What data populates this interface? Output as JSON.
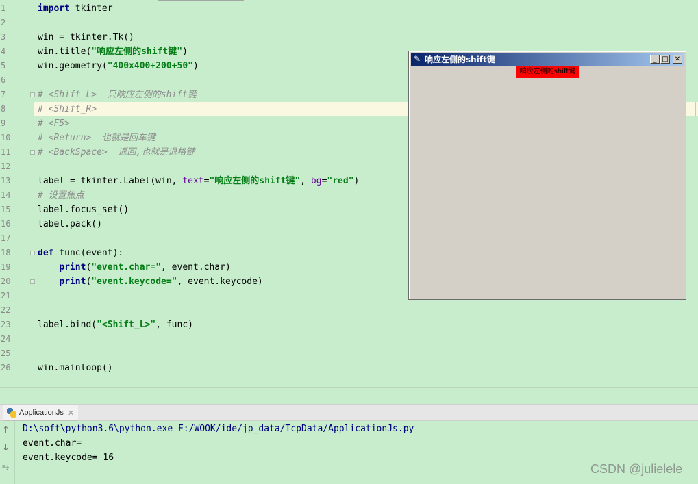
{
  "editor": {
    "lines": [
      {
        "n": "1",
        "spans": [
          [
            "kw",
            "import"
          ],
          [
            "plain",
            " tkinter"
          ]
        ]
      },
      {
        "n": "2",
        "spans": []
      },
      {
        "n": "3",
        "spans": [
          [
            "plain",
            "win = tkinter.Tk()"
          ]
        ]
      },
      {
        "n": "4",
        "spans": [
          [
            "plain",
            "win.title("
          ],
          [
            "str",
            "\"响应左侧的shift键\""
          ],
          [
            "plain",
            ")"
          ]
        ]
      },
      {
        "n": "5",
        "spans": [
          [
            "plain",
            "win.geometry("
          ],
          [
            "str",
            "\"400x400+200+50\""
          ],
          [
            "plain",
            ")"
          ]
        ]
      },
      {
        "n": "6",
        "spans": []
      },
      {
        "n": "7",
        "spans": [
          [
            "cmt",
            "# <Shift_L>  只响应左侧的shift键"
          ]
        ]
      },
      {
        "n": "8",
        "spans": [
          [
            "cmt",
            "# <Shift_R>"
          ]
        ]
      },
      {
        "n": "9",
        "spans": [
          [
            "cmt",
            "# <F5>"
          ]
        ]
      },
      {
        "n": "10",
        "spans": [
          [
            "cmt",
            "# <Return>  也就是回车键"
          ]
        ]
      },
      {
        "n": "11",
        "spans": [
          [
            "cmt",
            "# <BackSpace>  返回,也就是退格键"
          ]
        ]
      },
      {
        "n": "12",
        "spans": []
      },
      {
        "n": "13",
        "spans": [
          [
            "plain",
            "label = tkinter.Label(win, "
          ],
          [
            "param",
            "text"
          ],
          [
            "plain",
            "="
          ],
          [
            "str",
            "\"响应左侧的shift键\""
          ],
          [
            "plain",
            ", "
          ],
          [
            "param",
            "bg"
          ],
          [
            "plain",
            "="
          ],
          [
            "str",
            "\"red\""
          ],
          [
            "plain",
            ")"
          ]
        ]
      },
      {
        "n": "14",
        "spans": [
          [
            "cmt",
            "# 设置焦点"
          ]
        ]
      },
      {
        "n": "15",
        "spans": [
          [
            "plain",
            "label.focus_set()"
          ]
        ]
      },
      {
        "n": "16",
        "spans": [
          [
            "plain",
            "label.pack()"
          ]
        ]
      },
      {
        "n": "17",
        "spans": []
      },
      {
        "n": "18",
        "spans": [
          [
            "kw",
            "def"
          ],
          [
            "plain",
            " func(event):"
          ]
        ]
      },
      {
        "n": "19",
        "spans": [
          [
            "plain",
            "    "
          ],
          [
            "kw",
            "print"
          ],
          [
            "plain",
            "("
          ],
          [
            "str",
            "\"event.char=\""
          ],
          [
            "plain",
            ", event.char)"
          ]
        ]
      },
      {
        "n": "20",
        "spans": [
          [
            "plain",
            "    "
          ],
          [
            "kw",
            "print"
          ],
          [
            "plain",
            "("
          ],
          [
            "str",
            "\"event.keycode=\""
          ],
          [
            "plain",
            ", event.keycode)"
          ]
        ]
      },
      {
        "n": "21",
        "spans": []
      },
      {
        "n": "22",
        "spans": []
      },
      {
        "n": "23",
        "spans": [
          [
            "plain",
            "label.bind("
          ],
          [
            "str",
            "\"<Shift_L>\""
          ],
          [
            "plain",
            ", func)"
          ]
        ]
      },
      {
        "n": "24",
        "spans": []
      },
      {
        "n": "25",
        "spans": []
      },
      {
        "n": "26",
        "spans": [
          [
            "plain",
            "win.mainloop()"
          ]
        ]
      }
    ],
    "fold_lines": [
      7,
      11,
      18,
      20
    ]
  },
  "tk_window": {
    "title": "响应左侧的shift键",
    "label_text": "响应左侧的shift键",
    "label_bg": "#ff0000",
    "icon": "feather-icon"
  },
  "run_panel": {
    "tab_label": "ApplicationJs",
    "tab_icon": "python-icon",
    "output": [
      "D:\\soft\\python3.6\\python.exe F:/WOOK/ide/jp_data/TcpData/ApplicationJs.py",
      "event.char=",
      "event.keycode= 16"
    ]
  },
  "watermark": "CSDN @julielele",
  "colors": {
    "background": "#c7edcc",
    "current_line": "#fbf8e2",
    "keyword": "#000080",
    "string": "#067d17",
    "comment": "#8c8c8c",
    "param": "#660099"
  }
}
